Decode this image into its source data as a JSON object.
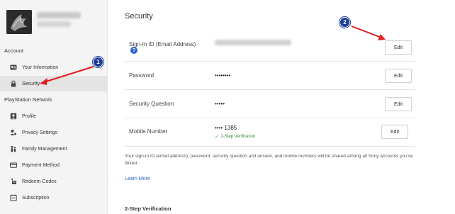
{
  "sidebar": {
    "account_label": "Account",
    "account_items": [
      {
        "label": "Your Information",
        "icon": "id-card-icon"
      },
      {
        "label": "Security",
        "icon": "lock-icon"
      }
    ],
    "network_label": "PlayStation Network",
    "network_items": [
      {
        "label": "Profile",
        "icon": "profile-icon"
      },
      {
        "label": "Privacy Settings",
        "icon": "privacy-settings-icon"
      },
      {
        "label": "Family Management",
        "icon": "family-icon"
      },
      {
        "label": "Payment Method",
        "icon": "payment-card-icon"
      },
      {
        "label": "Redeem Codes",
        "icon": "redeem-icon"
      },
      {
        "label": "Subscription",
        "icon": "subscription-icon"
      }
    ]
  },
  "main": {
    "title": "Security",
    "rows": [
      {
        "label": "Sign-In ID (Email Address)",
        "value": "",
        "help_icon": "?",
        "edit_label": "Edit"
      },
      {
        "label": "Password",
        "value": "••••••••",
        "edit_label": "Edit"
      },
      {
        "label": "Security Question",
        "value": "•••••",
        "edit_label": "Edit"
      },
      {
        "label": "Mobile Number",
        "value": "•••• 1385",
        "status": "2-Step Verification",
        "edit_label": "Edit"
      }
    ],
    "info_text": "Your sign-in ID (email address), password, security question and answer, and mobile numbers will be shared among all Sony accounts you've linked.",
    "learn_more": "Learn More",
    "two_step_title": "2-Step Verification"
  },
  "annotations": [
    {
      "number": "1"
    },
    {
      "number": "2"
    }
  ],
  "colors": {
    "accent_blue": "#2d64c8",
    "badge_blue": "#1c3f95",
    "arrow_red": "#e02020",
    "success_green": "#2b8a3e",
    "sidebar_bg": "#f4f4f4"
  }
}
